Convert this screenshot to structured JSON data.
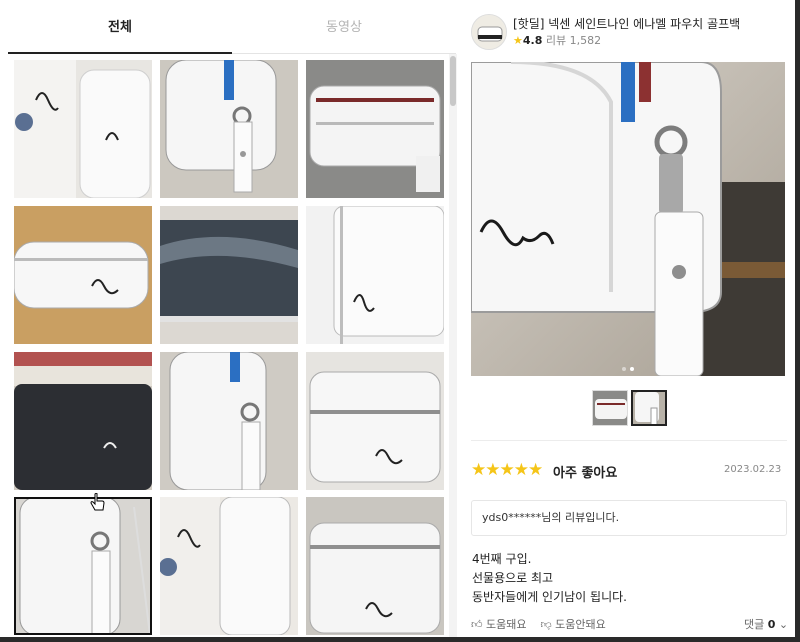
{
  "tabs": {
    "all": "전체",
    "video": "동영상"
  },
  "product": {
    "title": "[핫딜] 넥센 세인트나인 에나멜 파우치 골프백",
    "rating": "4.8",
    "review_label": "리뷰",
    "review_count": "1,582",
    "star_glyph": "★"
  },
  "review": {
    "stars": "★★★★★",
    "rating_label": "아주 좋아요",
    "date": "2023.02.23",
    "reviewer_id": "yds0******",
    "reviewer_suffix": "님의 리뷰입니다.",
    "body": [
      "4번째 구입.",
      "선물용으로 최고",
      "동반자들에게 인기남이 됩니다."
    ],
    "helpful": "도움돼요",
    "not_helpful": "도움안돼요",
    "comments_label": "댓글",
    "comments_count": "0"
  },
  "carousel": {
    "slide_count": 2,
    "current": 2,
    "selected_thumb": 12
  },
  "colors": {
    "accent": "#222222",
    "star": "#f5c518",
    "muted": "#b4b4b4"
  }
}
